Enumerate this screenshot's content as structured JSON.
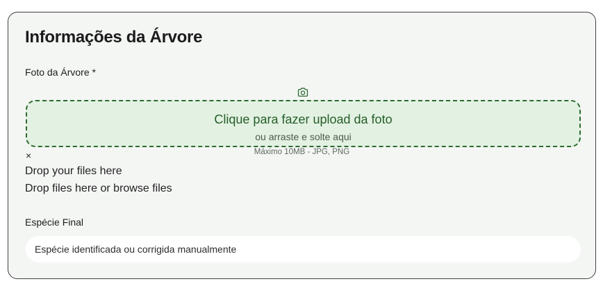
{
  "section": {
    "title": "Informações da Árvore"
  },
  "photo": {
    "label": "Foto da Árvore *",
    "icon": "camera-icon",
    "upload_title": "Clique para fazer upload da foto",
    "upload_subtitle": "ou arraste e solte aqui",
    "upload_limits": "Máximo 10MB - JPG, PNG",
    "close_glyph": "×",
    "drop_text_1": "Drop your files here",
    "drop_text_2": "Drop files here or browse files"
  },
  "species": {
    "label": "Espécie Final",
    "placeholder": "Espécie identificada ou corrigida manualmente",
    "value": ""
  },
  "colors": {
    "accent_green": "#245f28",
    "dropzone_bg": "#e3f1e3",
    "card_bg": "#f4f6f4"
  }
}
